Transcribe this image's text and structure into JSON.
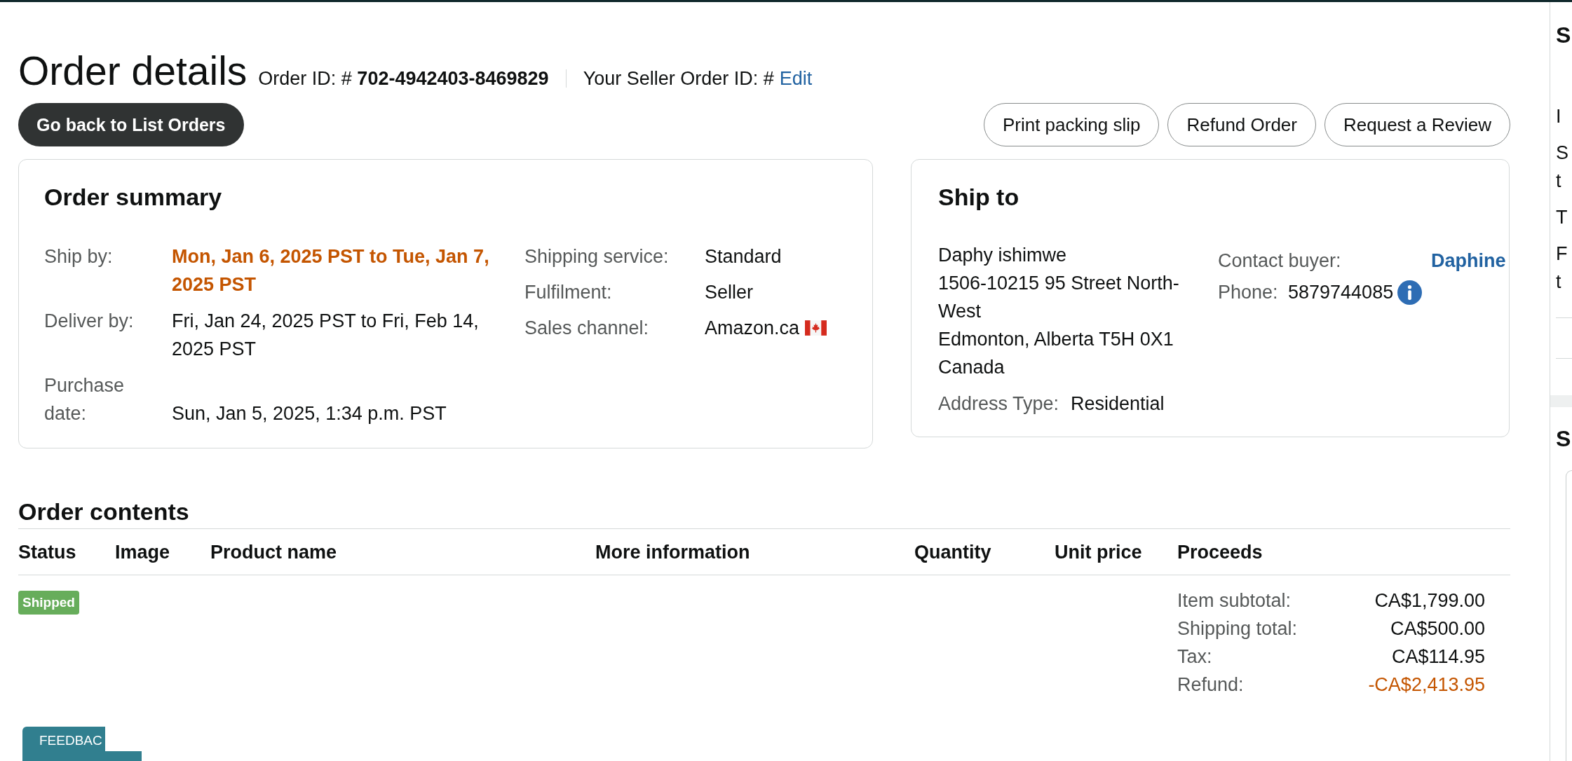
{
  "header": {
    "title": "Order details",
    "order_id": "Order ID: # **702-4942403-8469829**",
    "seller_order_id": {
      "label": "Your Seller Order ID: #",
      "link": "Edit"
    }
  },
  "back_button": "Go back to List Orders",
  "actions": [
    "Print packing slip",
    "Refund Order",
    "Request a Review"
  ],
  "order_summary": {
    "title": "Order summary",
    "left_fields": [
      {
        "label": "Ship by:",
        "value": "Mon, Jan 6, 2025 PST to Tue, Jan 7, 2025 PST",
        "highlighted": true
      },
      {
        "label": "Deliver by:",
        "value": "Fri, Jan 24, 2025 PST to Fri, Feb 14, 2025 PST",
        "highlighted": false
      },
      {
        "label": "Purchase date:",
        "value": "Sun, Jan 5, 2025, 1:34 p.m. PST",
        "highlighted": false
      }
    ],
    "right_fields": [
      {
        "label": "Shipping service:",
        "value": "Standard",
        "highlighted": false,
        "flag": false
      },
      {
        "label": "Fulfilment:",
        "value": "Seller",
        "highlighted": false,
        "flag": false
      },
      {
        "label": "Sales channel:",
        "value": "Amazon.ca",
        "highlighted": false,
        "flag": true
      }
    ]
  },
  "ship_to": {
    "title": "Ship to",
    "address": [
      "Daphy ishimwe",
      "1506-10215 95 Street North-West",
      "Edmonton, Alberta T5H 0X1",
      "Canada"
    ],
    "address_type": {
      "label": "Address Type:",
      "value": "Residential"
    },
    "contact_buyer": {
      "label": "Contact buyer:",
      "name": "Daphine"
    },
    "phone": {
      "label": "Phone:",
      "value": "5879744085"
    }
  },
  "order_contents": {
    "title": "Order contents",
    "columns": [
      "Status",
      "Image",
      "Product name",
      "More information",
      "Quantity",
      "Unit price",
      "Proceeds"
    ],
    "rows": [
      {
        "status": {
          "label": "Shipped",
          "color": "#67ad5b"
        },
        "proceeds": [
          {
            "label": "Item subtotal:",
            "value": "CA$1,799.00",
            "kind": "charge"
          },
          {
            "label": "Shipping total:",
            "value": "CA$500.00",
            "kind": "charge"
          },
          {
            "label": "Tax:",
            "value": "CA$114.95",
            "kind": "charge"
          },
          {
            "label": "Refund:",
            "value": "-CA$2,413.95",
            "kind": "refund"
          }
        ]
      }
    ]
  },
  "feedback_tab": {
    "label": "FEEDBAC"
  },
  "side_panel": {
    "heading": "S",
    "paragraphs": [
      [
        "I"
      ],
      [
        "S",
        "t"
      ],
      [
        "T"
      ],
      [
        "F",
        "t"
      ]
    ],
    "second_heading": "S"
  }
}
